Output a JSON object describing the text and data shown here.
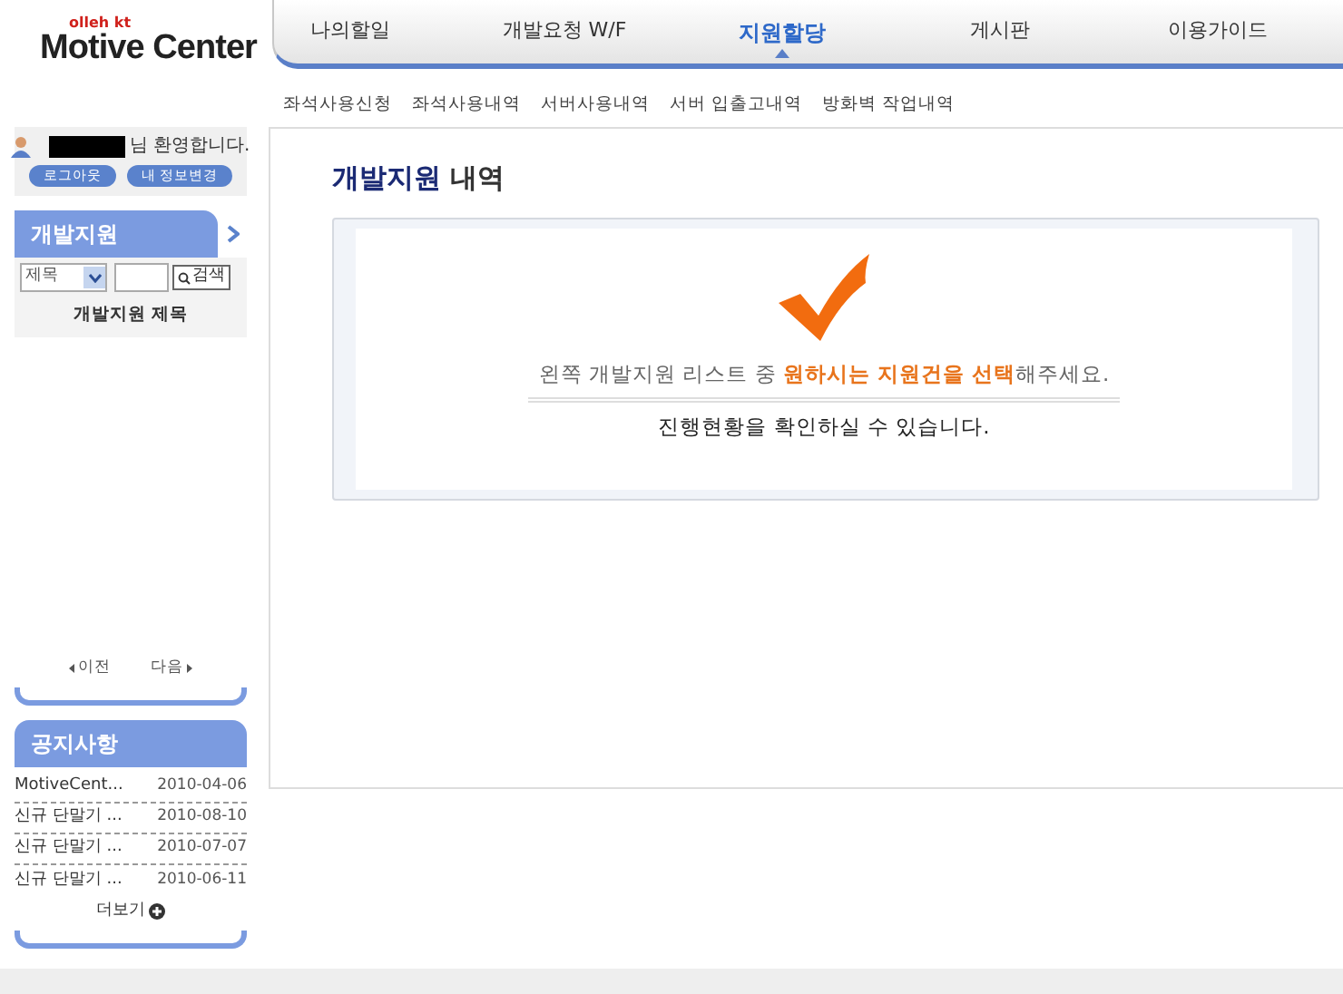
{
  "logo": {
    "brand": "olleh kt",
    "title": "Motive Center"
  },
  "nav": [
    {
      "label": "나의할일",
      "selected": false
    },
    {
      "label": "개발요청 W/F",
      "selected": false
    },
    {
      "label": "지원할당",
      "selected": true
    },
    {
      "label": "게시판",
      "selected": false
    },
    {
      "label": "이용가이드",
      "selected": false
    }
  ],
  "subnav": [
    "좌석사용신청",
    "좌석사용내역",
    "서버사용내역",
    "서버 입출고내역",
    "방화벽 작업내역"
  ],
  "user": {
    "greeting": "님 환영합니다.",
    "buttons": [
      "로그아웃",
      "내 정보변경"
    ]
  },
  "support_panel": {
    "title": "개발지원",
    "select": "제목",
    "search_button": "검색",
    "column": "개발지원 제목",
    "prev": "이전",
    "next": "다음"
  },
  "notice_panel": {
    "title": "공지사항",
    "items": [
      {
        "title": "MotiveCent...",
        "date": "2010-04-06"
      },
      {
        "title": "신규 단말기 ...",
        "date": "2010-08-10"
      },
      {
        "title": "신규 단말기 ...",
        "date": "2010-07-07"
      },
      {
        "title": "신규 단말기 ...",
        "date": "2010-06-11"
      }
    ],
    "more": "더보기"
  },
  "content": {
    "title": [
      {
        "text": "개발지원",
        "highlight": true
      },
      {
        "text": " 내역",
        "highlight": false
      }
    ],
    "message": [
      {
        "text": "왼쪽 개발지원 리스트 중 ",
        "highlight": false
      },
      {
        "text": "원하시는 지원건을 선택",
        "highlight": true
      },
      {
        "text": "해주세요.",
        "highlight": false
      }
    ],
    "sub_message": "진행현황을 확인하실 수 있습니다."
  }
}
